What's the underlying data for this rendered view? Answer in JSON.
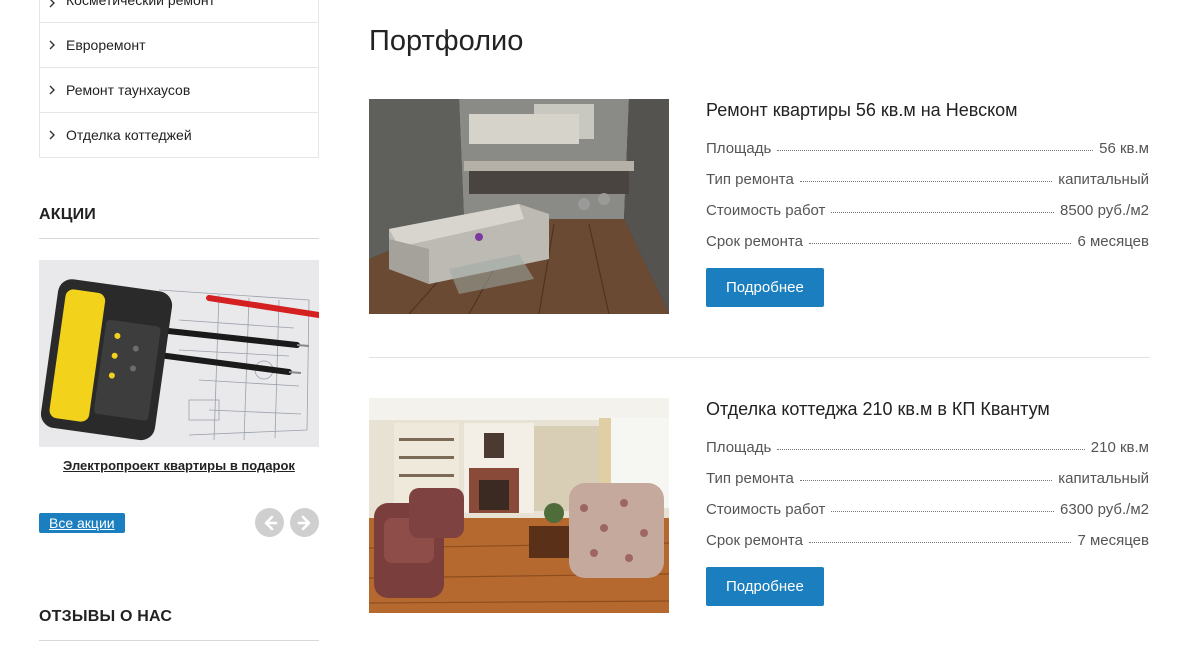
{
  "sidebar": {
    "menu": [
      {
        "label": "Косметический ремонт"
      },
      {
        "label": "Евроремонт"
      },
      {
        "label": "Ремонт таунхаусов"
      },
      {
        "label": "Отделка коттеджей"
      }
    ],
    "promos": {
      "title": "АКЦИИ",
      "item_label": "Электропроект квартиры в подарок",
      "all_label": "Все акции",
      "prev_icon": "arrow-left-icon",
      "next_icon": "arrow-right-icon"
    },
    "reviews": {
      "title": "ОТЗЫВЫ О НАС"
    }
  },
  "main": {
    "title": "Портфолио",
    "items": [
      {
        "title": "Ремонт квартиры 56 кв.м на Невском",
        "specs": [
          {
            "label": "Площадь",
            "value": "56 кв.м"
          },
          {
            "label": "Тип ремонта",
            "value": "капитальный"
          },
          {
            "label": "Стоимость работ",
            "value": "8500 руб./м2"
          },
          {
            "label": "Срок ремонта",
            "value": "6 месяцев"
          }
        ],
        "button": "Подробнее"
      },
      {
        "title": "Отделка коттеджа 210 кв.м в КП Квантум",
        "specs": [
          {
            "label": "Площадь",
            "value": "210 кв.м"
          },
          {
            "label": "Тип ремонта",
            "value": "капитальный"
          },
          {
            "label": "Стоимость работ",
            "value": "6300 руб./м2"
          },
          {
            "label": "Срок ремонта",
            "value": "7 месяцев"
          }
        ],
        "button": "Подробнее"
      }
    ]
  },
  "colors": {
    "accent": "#1b7fbf",
    "text": "#222222",
    "muted": "#555555",
    "border": "#e6e6e6"
  }
}
